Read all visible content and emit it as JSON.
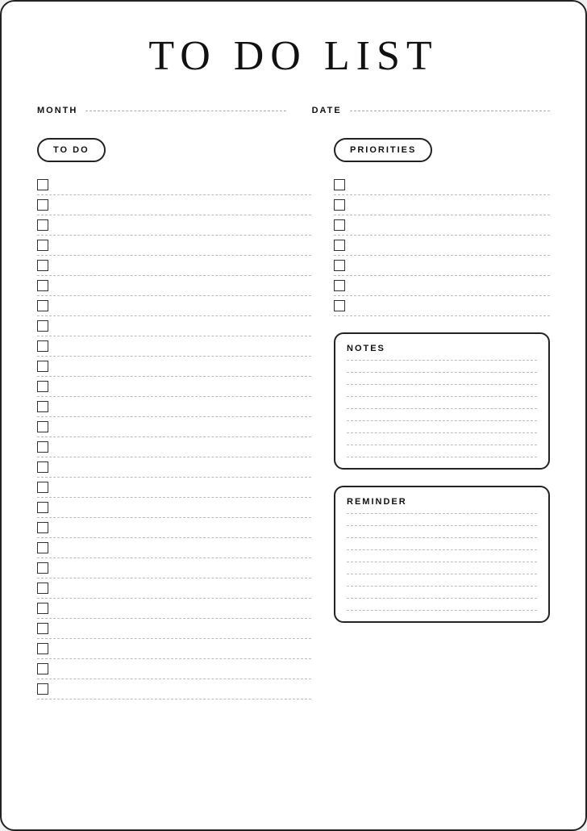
{
  "title": "TO DO LIST",
  "meta": {
    "month_label": "MONTH",
    "date_label": "DATE"
  },
  "todo_section": {
    "label": "TO DO",
    "item_count": 26
  },
  "priorities_section": {
    "label": "PRIORITIES",
    "item_count": 7
  },
  "notes_section": {
    "label": "NOTES",
    "line_count": 9
  },
  "reminder_section": {
    "label": "REMINDER",
    "line_count": 9
  }
}
